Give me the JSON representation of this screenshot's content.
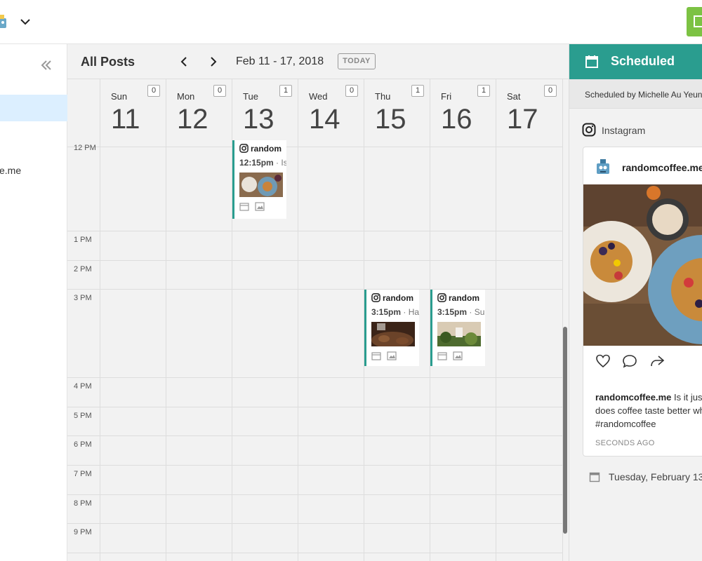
{
  "sidebar": {
    "account_label": "e.me"
  },
  "calendar": {
    "title": "All Posts",
    "range": "Feb 11 - 17, 2018",
    "today_label": "TODAY",
    "days": [
      {
        "name": "Sun",
        "num": "11",
        "count": "0"
      },
      {
        "name": "Mon",
        "num": "12",
        "count": "0"
      },
      {
        "name": "Tue",
        "num": "13",
        "count": "1"
      },
      {
        "name": "Wed",
        "num": "14",
        "count": "0"
      },
      {
        "name": "Thu",
        "num": "15",
        "count": "1"
      },
      {
        "name": "Fri",
        "num": "16",
        "count": "1"
      },
      {
        "name": "Sat",
        "num": "17",
        "count": "0"
      }
    ],
    "times": [
      "12 PM",
      "1 PM",
      "2 PM",
      "3 PM",
      "4 PM",
      "5 PM",
      "6 PM",
      "7 PM",
      "8 PM",
      "9 PM"
    ],
    "events": [
      {
        "account": "random",
        "time": "12:15pm",
        "rest": " · Is"
      },
      {
        "account": "random",
        "time": "3:15pm",
        "rest": " · Ha"
      },
      {
        "account": "random",
        "time": "3:15pm",
        "rest": " · Su"
      }
    ]
  },
  "panel": {
    "title": "Scheduled",
    "scheduled_by": "Scheduled by Michelle Au Yeung",
    "network": "Instagram",
    "post": {
      "username": "randomcoffee.me",
      "caption_user": "randomcoffee.me",
      "caption_text": " Is it just me or does coffee taste better when it's #randomcoffee",
      "time_ago": "SECONDS AGO"
    },
    "date": "Tuesday, February 13"
  },
  "colors": {
    "accent": "#2a9d8f",
    "green": "#7cc243",
    "selected": "#dcefff"
  }
}
